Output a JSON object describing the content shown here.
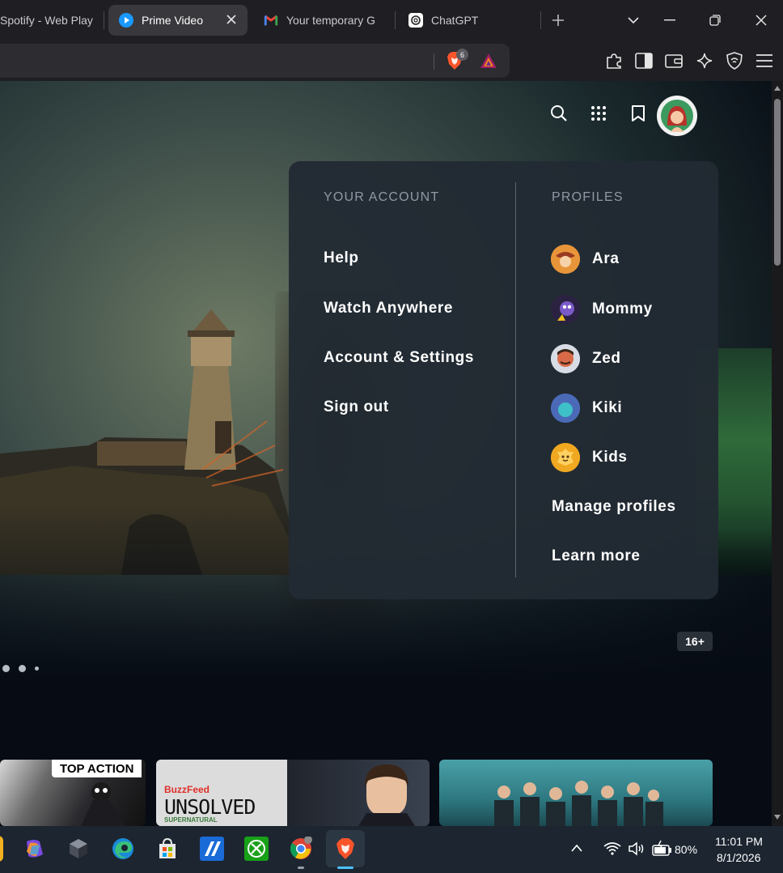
{
  "browser": {
    "tabs": [
      {
        "title": "Spotify - Web Play",
        "active": false
      },
      {
        "title": "Prime Video",
        "active": true
      },
      {
        "title": "Your temporary G",
        "active": false
      },
      {
        "title": "ChatGPT",
        "active": false
      }
    ],
    "brave_shield_count": "6"
  },
  "account_menu": {
    "your_account_heading": "YOUR ACCOUNT",
    "profiles_heading": "PROFILES",
    "account_links": [
      "Help",
      "Watch Anywhere",
      "Account & Settings",
      "Sign out"
    ],
    "profiles": [
      {
        "name": "Ara",
        "color": "#e8953a"
      },
      {
        "name": "Mommy",
        "color": "#6a4aa8"
      },
      {
        "name": "Zed",
        "color": "#c85040"
      },
      {
        "name": "Kiki",
        "color": "#4a6ab8"
      },
      {
        "name": "Kids",
        "color": "#f0a820"
      }
    ],
    "manage_profiles": "Manage profiles",
    "learn_more": "Learn more"
  },
  "hero": {
    "maturity_rating": "16+"
  },
  "carousel": {
    "cards": [
      {
        "badge": "TOP ACTION"
      },
      {
        "brand": "BuzzFeed",
        "title": "UNSOLVED",
        "subtitle": "SUPERNATURAL"
      },
      {}
    ]
  },
  "taskbar": {
    "battery": "80%",
    "time": "11:01 PM",
    "date": "8/1/2026"
  },
  "colors": {
    "accent_blue": "#1a98ff",
    "brave_orange": "#fb542b"
  }
}
